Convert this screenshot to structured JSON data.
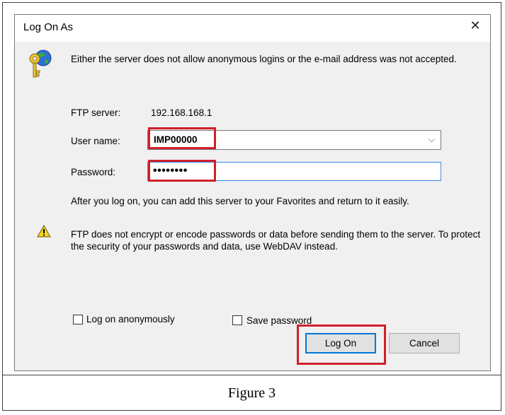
{
  "window": {
    "title": "Log On As"
  },
  "message": "Either the server does not allow anonymous logins or the e-mail address was not accepted.",
  "ftp_server": {
    "label": "FTP server:",
    "value": "192.168.168.1"
  },
  "user_name": {
    "label": "User name:",
    "value": "IMP00000"
  },
  "password": {
    "label": "Password:",
    "value": "••••••••"
  },
  "info_text": "After you log on, you can add this server to your Favorites and return to it easily.",
  "warning_text": "FTP does not encrypt or encode passwords or data before sending them to the server.  To protect the security of your passwords and data, use WebDAV instead.",
  "checkboxes": {
    "anonymous": {
      "label": "Log on anonymously",
      "checked": false
    },
    "save_password": {
      "label": "Save password",
      "checked": false
    }
  },
  "buttons": {
    "log_on": "Log On",
    "cancel": "Cancel"
  },
  "caption": "Figure 3",
  "colors": {
    "highlight": "#d0202a",
    "focus_border": "#0078d7"
  }
}
